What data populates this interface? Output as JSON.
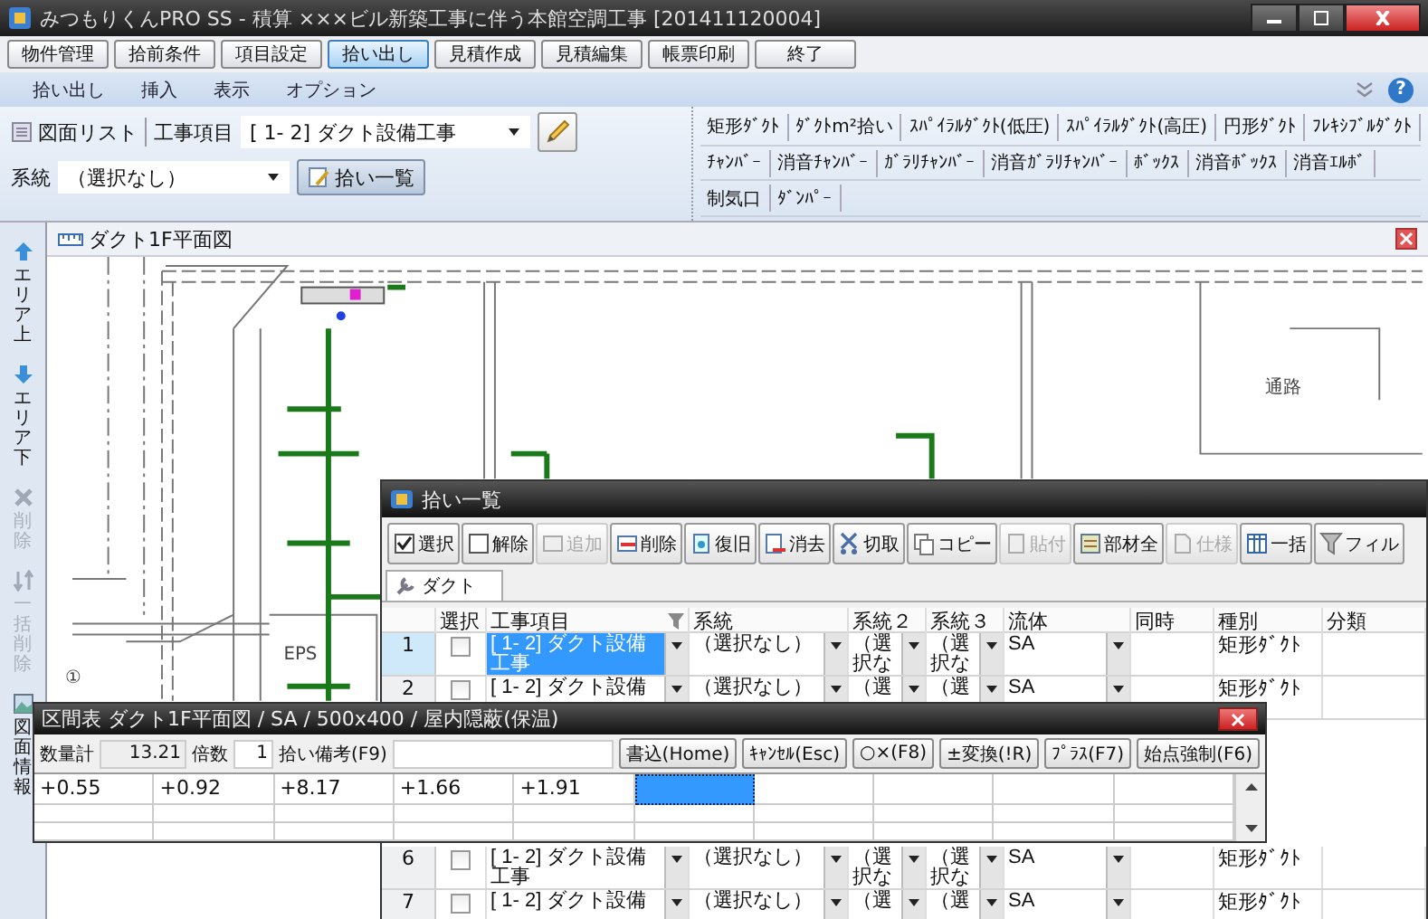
{
  "window": {
    "title": "みつもりくんPRO SS - 積算  ×××ビル新築工事に伴う本館空調工事 [201411120004]"
  },
  "main_menu": [
    {
      "label": "物件管理",
      "selected": false
    },
    {
      "label": "拾前条件",
      "selected": false
    },
    {
      "label": "項目設定",
      "selected": false
    },
    {
      "label": "拾い出し",
      "selected": true
    },
    {
      "label": "見積作成",
      "selected": false
    },
    {
      "label": "見積編集",
      "selected": false
    },
    {
      "label": "帳票印刷",
      "selected": false
    },
    {
      "label": "終了",
      "selected": false
    }
  ],
  "ribbon_tabs": [
    {
      "label": "拾い出し"
    },
    {
      "label": "挿入"
    },
    {
      "label": "表示"
    },
    {
      "label": "オプション"
    }
  ],
  "help": "?",
  "toolbar": {
    "drawing_list": "図面リスト",
    "item_label": "工事項目",
    "item_value": "[ 1- 2] ダクト設備工事",
    "system_label": "系統",
    "system_value": "（選択なし）",
    "pickup_list_button": "拾い一覧"
  },
  "part_buttons": [
    {
      "buttons": [
        "矩形ﾀﾞｸﾄ",
        "ﾀﾞｸﾄm²拾い",
        "ｽﾊﾟｲﾗﾙﾀﾞｸﾄ(低圧)",
        "ｽﾊﾟｲﾗﾙﾀﾞｸﾄ(高圧)",
        "円形ﾀﾞｸﾄ",
        "ﾌﾚｷｼﾌﾞﾙﾀﾞｸﾄ"
      ]
    },
    {
      "buttons": [
        "ﾁｬﾝﾊﾞｰ",
        "消音ﾁｬﾝﾊﾞｰ",
        "ｶﾞﾗﾘﾁｬﾝﾊﾞｰ",
        "消音ｶﾞﾗﾘﾁｬﾝﾊﾞｰ",
        "ﾎﾞｯｸｽ",
        "消音ﾎﾞｯｸｽ",
        "消音ｴﾙﾎﾞ"
      ]
    },
    {
      "buttons": [
        "制気口",
        "ﾀﾞﾝﾊﾟｰ"
      ]
    }
  ],
  "side_tools": [
    {
      "label": "エリア上",
      "disabled": false
    },
    {
      "label": "エリア下",
      "disabled": false
    },
    {
      "label": "削除",
      "disabled": true
    },
    {
      "label": "一括削除",
      "disabled": true
    },
    {
      "label": "図面情報",
      "disabled": false
    }
  ],
  "drawing": {
    "tab": "ダクト1F平面図",
    "labels": [
      "EPS",
      "通路",
      "①"
    ]
  },
  "pickup_window": {
    "title": "拾い一覧",
    "tools": [
      {
        "label": "選択",
        "disabled": false
      },
      {
        "label": "解除",
        "disabled": false
      },
      {
        "label": "追加",
        "disabled": true
      },
      {
        "label": "削除",
        "disabled": false
      },
      {
        "label": "復旧",
        "disabled": false
      },
      {
        "label": "消去",
        "disabled": false
      },
      {
        "label": "切取",
        "disabled": false
      },
      {
        "label": "コピー",
        "disabled": false
      },
      {
        "label": "貼付",
        "disabled": true
      },
      {
        "label": "部材全",
        "disabled": false
      },
      {
        "label": "仕様",
        "disabled": true
      },
      {
        "label": "一括",
        "disabled": false
      },
      {
        "label": "フィル",
        "disabled": false
      }
    ],
    "tabs": [
      {
        "label": "ダクト",
        "selected": true
      }
    ],
    "columns": [
      "選択",
      "工事項目",
      "系統",
      "系統２",
      "系統３",
      "流体",
      "同時",
      "種別",
      "分類"
    ],
    "rows": [
      {
        "number": "1",
        "selected": true,
        "checked": false,
        "item": "[ 1- 2] ダクト設備工事",
        "system": "（選択なし）",
        "system_2": "（選択な",
        "system_3": "（選択な",
        "fluid": "SA",
        "type": "矩形ﾀﾞｸﾄ"
      },
      {
        "number": "2",
        "selected": false,
        "checked": false,
        "item": "[ 1- 2] ダクト設備",
        "system": "（選択なし）",
        "system_2": "（選",
        "system_3": "（選",
        "fluid": "SA",
        "type": "矩形ﾀﾞｸﾄ"
      },
      {
        "number": "6",
        "selected": false,
        "checked": false,
        "item": "[ 1- 2] ダクト設備工事",
        "system": "（選択なし）",
        "system_2": "（選択な",
        "system_3": "（選択な",
        "fluid": "SA",
        "type": "矩形ﾀﾞｸﾄ"
      },
      {
        "number": "7",
        "selected": false,
        "checked": false,
        "item": "[ 1- 2] ダクト設備",
        "system": "（選択なし）",
        "system_2": "（選",
        "system_3": "（選",
        "fluid": "SA",
        "type": "矩形ﾀﾞｸﾄ"
      }
    ]
  },
  "section_dialog": {
    "title": "区間表 ダクト1F平面図 / SA / 500x400 / 屋内隠蔽(保温)",
    "total_label": "数量計",
    "total_value": "13.21",
    "multiplier_label": "倍数",
    "multiplier_value": "1",
    "remark_label": "拾い備考(F9)",
    "buttons": [
      "書込(Home)",
      "ｷｬﾝｾﾙ(Esc)",
      "○×(F8)",
      "±変換(!R)",
      "ﾌﾟﾗｽ(F7)",
      "始点強制(F6)"
    ],
    "cells": [
      {
        "value": "+0.55",
        "selected": false
      },
      {
        "value": "+0.92",
        "selected": false
      },
      {
        "value": "+8.17",
        "selected": false
      },
      {
        "value": "+1.66",
        "selected": false
      },
      {
        "value": "+1.91",
        "selected": false
      },
      {
        "selected": true
      }
    ]
  }
}
